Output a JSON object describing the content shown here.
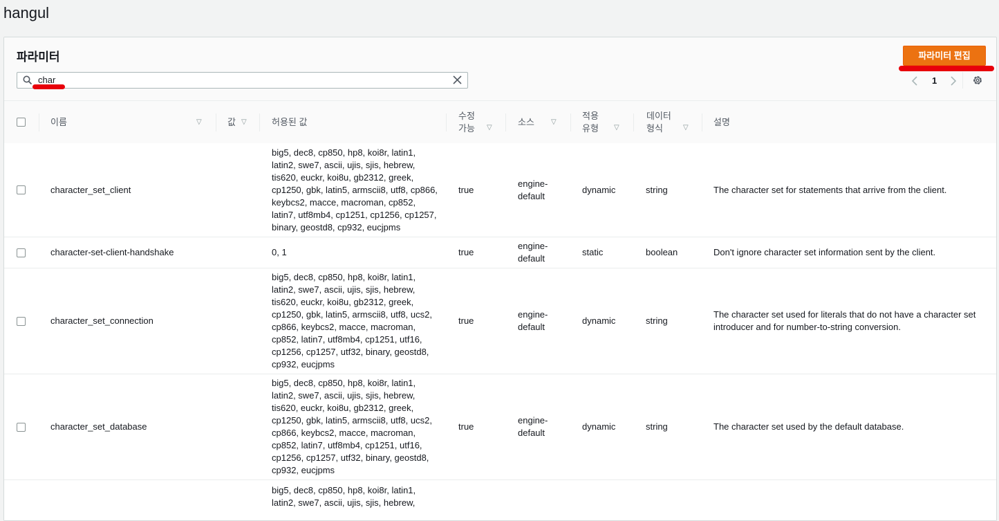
{
  "page": {
    "title": "hangul"
  },
  "panel": {
    "title": "파라미터",
    "edit_button": "파라미터 편집"
  },
  "search": {
    "value": "char"
  },
  "pager": {
    "current": "1"
  },
  "columns": {
    "name": "이름",
    "value": "값",
    "allowed": "허용된 값",
    "modifiable": "수정\n가능",
    "source": "소스",
    "apply_type": "적용\n유형",
    "data_type": "데이터\n형식",
    "description": "설명"
  },
  "rows": [
    {
      "name": "character_set_client",
      "value": "",
      "allowed": "big5, dec8, cp850, hp8, koi8r, latin1, latin2, swe7, ascii, ujis, sjis, hebrew, tis620, euckr, koi8u, gb2312, greek, cp1250, gbk, latin5, armscii8, utf8, cp866, keybcs2, macce, macroman, cp852, latin7, utf8mb4, cp1251, cp1256, cp1257, binary, geostd8, cp932, eucjpms",
      "modifiable": "true",
      "source": "engine-default",
      "apply_type": "dynamic",
      "data_type": "string",
      "description": "The character set for statements that arrive from the client."
    },
    {
      "name": "character-set-client-handshake",
      "value": "",
      "allowed": "0, 1",
      "modifiable": "true",
      "source": "engine-default",
      "apply_type": "static",
      "data_type": "boolean",
      "description": "Don't ignore character set information sent by the client."
    },
    {
      "name": "character_set_connection",
      "value": "",
      "allowed": "big5, dec8, cp850, hp8, koi8r, latin1, latin2, swe7, ascii, ujis, sjis, hebrew, tis620, euckr, koi8u, gb2312, greek, cp1250, gbk, latin5, armscii8, utf8, ucs2, cp866, keybcs2, macce, macroman, cp852, latin7, utf8mb4, cp1251, utf16, cp1256, cp1257, utf32, binary, geostd8, cp932, eucjpms",
      "modifiable": "true",
      "source": "engine-default",
      "apply_type": "dynamic",
      "data_type": "string",
      "description": "The character set used for literals that do not have a character set introducer and for number-to-string conversion."
    },
    {
      "name": "character_set_database",
      "value": "",
      "allowed": "big5, dec8, cp850, hp8, koi8r, latin1, latin2, swe7, ascii, ujis, sjis, hebrew, tis620, euckr, koi8u, gb2312, greek, cp1250, gbk, latin5, armscii8, utf8, ucs2, cp866, keybcs2, macce, macroman, cp852, latin7, utf8mb4, cp1251, utf16, cp1256, cp1257, utf32, binary, geostd8, cp932, eucjpms",
      "modifiable": "true",
      "source": "engine-default",
      "apply_type": "dynamic",
      "data_type": "string",
      "description": "The character set used by the default database."
    },
    {
      "name": "",
      "value": "",
      "allowed": "big5, dec8, cp850, hp8, koi8r, latin1, latin2, swe7, ascii, ujis, sjis, hebrew,",
      "modifiable": "",
      "source": "",
      "apply_type": "",
      "data_type": "",
      "description": ""
    }
  ],
  "colors": {
    "accent": "#ec7211",
    "annotation": "#e8000b"
  }
}
